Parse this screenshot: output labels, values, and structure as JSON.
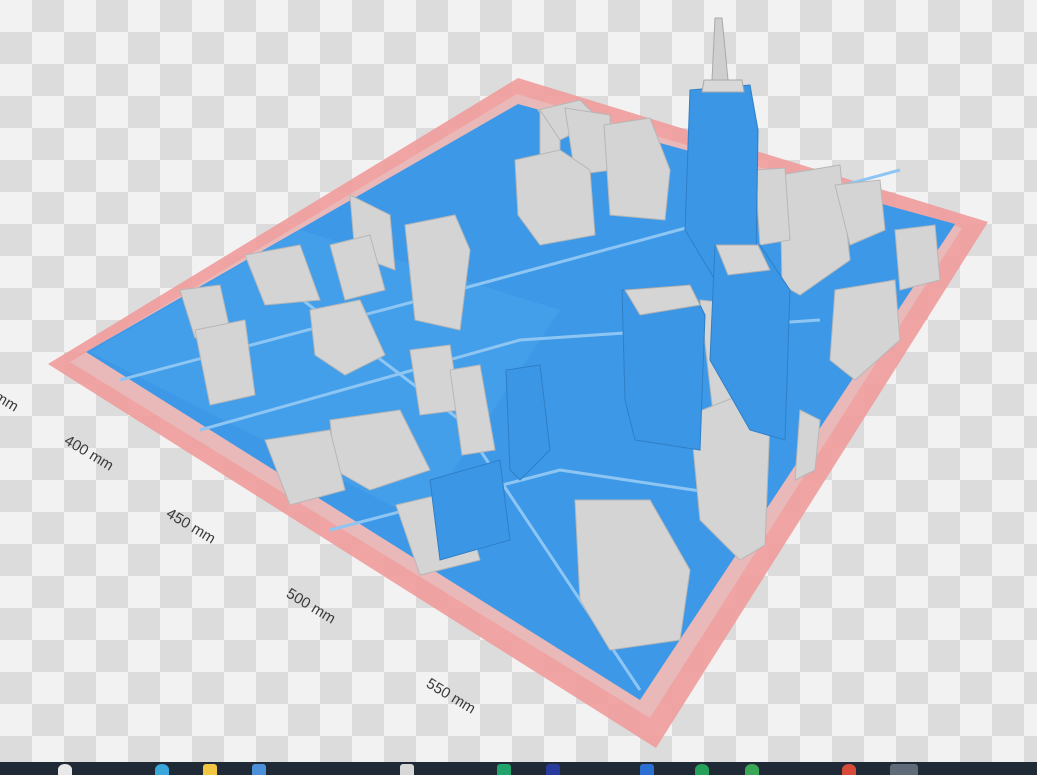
{
  "viewport": {
    "axis_labels": [
      "mm",
      "400 mm",
      "450 mm",
      "500 mm",
      "550 mm"
    ]
  },
  "colors": {
    "background_light": "#f2f2f2",
    "background_check": "#dcdcdc",
    "build_plate_border": "#ef8f8f",
    "model_blue": "#3d99e8",
    "model_gray": "#d2d2d2",
    "taskbar": "#1f2a36"
  },
  "taskbar": {
    "icons": [
      "search-icon",
      "edge-browser-icon",
      "file-explorer-icon",
      "store-icon",
      "mail-icon",
      "app-icon-green",
      "app-icon-dark",
      "app-icon-blue",
      "app-icon-teal",
      "chrome-icon",
      "app-icon-red",
      "app-icon-gray"
    ]
  }
}
